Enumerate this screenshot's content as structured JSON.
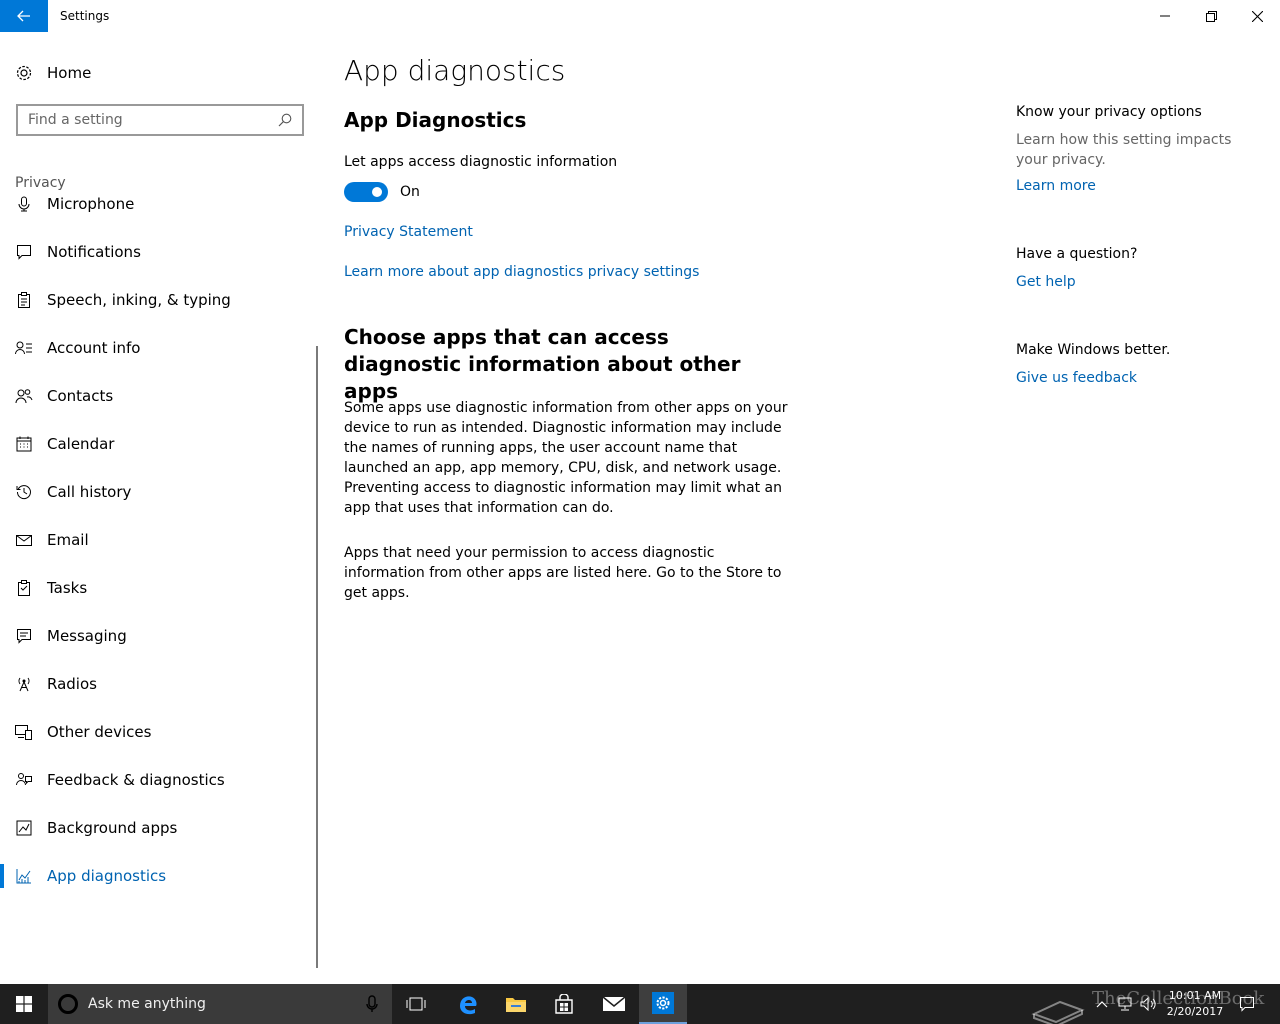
{
  "window": {
    "title": "Settings"
  },
  "sidebar": {
    "home_label": "Home",
    "search_placeholder": "Find a setting",
    "section_label": "Privacy",
    "items": [
      {
        "label": "Microphone",
        "icon": "microphone-icon"
      },
      {
        "label": "Notifications",
        "icon": "notification-icon"
      },
      {
        "label": "Speech, inking, & typing",
        "icon": "speech-icon"
      },
      {
        "label": "Account info",
        "icon": "account-info-icon"
      },
      {
        "label": "Contacts",
        "icon": "contacts-icon"
      },
      {
        "label": "Calendar",
        "icon": "calendar-icon"
      },
      {
        "label": "Call history",
        "icon": "history-icon"
      },
      {
        "label": "Email",
        "icon": "email-icon"
      },
      {
        "label": "Tasks",
        "icon": "tasks-icon"
      },
      {
        "label": "Messaging",
        "icon": "messaging-icon"
      },
      {
        "label": "Radios",
        "icon": "radio-icon"
      },
      {
        "label": "Other devices",
        "icon": "devices-icon"
      },
      {
        "label": "Feedback & diagnostics",
        "icon": "feedback-icon"
      },
      {
        "label": "Background apps",
        "icon": "background-apps-icon"
      },
      {
        "label": "App diagnostics",
        "icon": "app-diagnostics-icon",
        "active": true
      }
    ]
  },
  "main": {
    "page_title": "App diagnostics",
    "section_title": "App Diagnostics",
    "setting_label": "Let apps access diagnostic information",
    "toggle_state": "On",
    "link_privacy": "Privacy Statement",
    "link_learn_more": "Learn more about app diagnostics privacy settings",
    "sub_title": "Choose apps that can access diagnostic information about other apps",
    "paragraph1": "Some apps use diagnostic information from other apps on your device to run as intended. Diagnostic information may include the names of running apps, the user account name that launched an app, app memory, CPU, disk, and network usage. Preventing access to diagnostic information may limit what an app that uses that information can do.",
    "paragraph2": "Apps that need your permission to access diagnostic information from other apps are listed here. Go to the Store to get apps."
  },
  "right": {
    "privacy_heading": "Know your privacy options",
    "privacy_desc": "Learn how this setting impacts your privacy.",
    "learn_more": "Learn more",
    "question_heading": "Have a question?",
    "get_help": "Get help",
    "better_heading": "Make Windows better.",
    "feedback": "Give us feedback"
  },
  "taskbar": {
    "search_placeholder": "Ask me anything",
    "time": "10:01 AM",
    "date": "2/20/2017",
    "watermark": "TheCollectionBook"
  },
  "colors": {
    "accent": "#0078d7",
    "link": "#0063b1",
    "taskbar": "#1f1f1f"
  }
}
